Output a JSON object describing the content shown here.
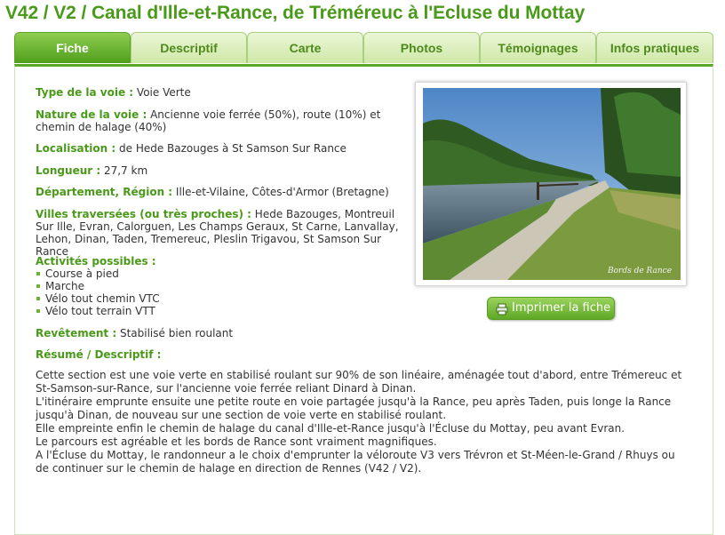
{
  "page_title": "V42 / V2 / Canal d'Ille-et-Rance, de Tréméreuc à l'Ecluse du Mottay",
  "tabs": [
    {
      "label": "Fiche"
    },
    {
      "label": "Descriptif"
    },
    {
      "label": "Carte"
    },
    {
      "label": "Photos"
    },
    {
      "label": "Témoignages"
    },
    {
      "label": "Infos pratiques"
    }
  ],
  "details": {
    "type_voie": {
      "label": "Type de la voie :",
      "value": "Voie Verte"
    },
    "nature_voie": {
      "label": "Nature de la voie :",
      "value": "Ancienne voie ferrée (50%), route (10%) et chemin de halage (40%)"
    },
    "localisation": {
      "label": "Localisation :",
      "value": "de Hede Bazouges à St Samson Sur Rance"
    },
    "longueur": {
      "label": "Longueur :",
      "value": "27,7 km"
    },
    "departement": {
      "label": "Département, Région :",
      "value": "Ille-et-Vilaine, Côtes-d'Armor (Bretagne)"
    },
    "villes": {
      "label": "Villes traversées (ou très proches) :",
      "value": "Hede Bazouges, Montreuil Sur Ille, Evran, Calorguen, Les Champs Geraux, St Carne, Lanvallay, Lehon, Dinan, Taden, Tremereuc, Pleslin Trigavou, St Samson Sur Rance"
    },
    "activites": {
      "label": "Activités possibles :",
      "items": [
        "Course à pied",
        "Marche",
        "Vélo tout chemin VTC",
        "Vélo tout terrain VTT"
      ]
    },
    "revetement": {
      "label": "Revêtement :",
      "value": "Stabilisé bien roulant"
    },
    "resume_label": "Résumé / Descriptif :"
  },
  "summary": [
    "Cette section est une voie verte en stabilisé roulant sur 90% de son linéaire, aménagée tout d'abord, entre Trémereuc et St-Samson-sur-Rance, sur l'ancienne voie ferrée reliant Dinard à Dinan.",
    "L'itinéraire emprunte ensuite une petite route en voie partagée jusqu'à la Rance, peu après Taden, puis longe la Rance jusqu'à Dinan, de nouveau sur une section de voie verte en stabilisé roulant.",
    "Elle empreinte enfin le chemin de halage du canal d'Ille-et-Rance jusqu'à l'Écluse du Mottay, peu avant Evran.",
    "Le parcours est agréable et les bords de Rance sont vraiment magnifiques.",
    "A l'Écluse du Mottay, le randonneur a le choix d'emprunter la véloroute V3 vers Trévron et St-Méen-le-Grand / Rhuys ou de continuer sur le chemin de halage en direction de Rennes (V42 / V2)."
  ],
  "photo": {
    "caption": "Bords de Rance"
  },
  "print_button": {
    "label": "Imprimer la fiche",
    "icon": "printer-icon"
  },
  "colors": {
    "accent": "#4a9a1a",
    "tab_active": "#5aa825",
    "tab_inactive": "#d9eebb"
  }
}
